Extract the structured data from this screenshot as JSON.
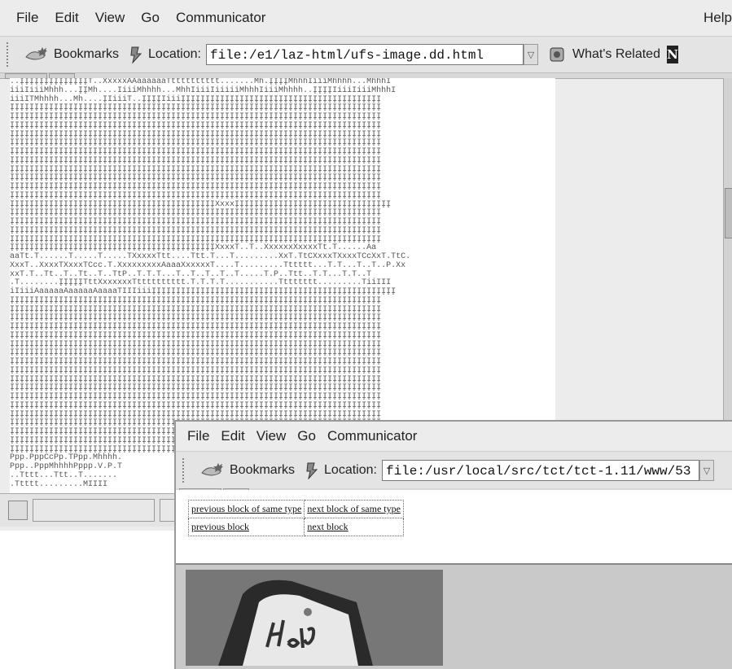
{
  "browser1": {
    "menu": [
      "File",
      "Edit",
      "View",
      "Go",
      "Communicator"
    ],
    "help": "Help",
    "bookmarks_label": "Bookmarks",
    "location_label": "Location:",
    "location_value": "file:/e1/laz-html/ufs-image.dd.html",
    "related_label": "What's Related",
    "content_ascii": [
      "..ĮĮĮĮĮĮĮĮĮĮĮĮĮĮT..XxxxxAAaaaaaaTtttttttttt.......Mh.ĮĮĮĮMhhhIiiiMhhhh...MhhhI",
      "iiiIiiiMhhh...ĮĮMh....IiiiMhhhh...MhhIiiiIiiiiiMhhhIiiiMhhhh..ĮĮĮĮIiiiIiiiMhhhI",
      "iiiITMhhhh...Mh....ĮIiiiT..ĮĮĮĮIiiiĮĮĮĮĮĮĮĮĮĮĮĮĮĮĮĮĮĮĮĮĮĮĮĮĮĮĮĮĮĮĮĮĮĮĮĮĮĮĮĮĮ",
      "ĮĮĮĮĮĮĮĮĮĮĮĮĮĮĮĮĮĮĮĮĮĮĮĮĮĮĮĮĮĮĮĮĮĮĮĮĮĮĮĮĮĮĮĮĮĮĮĮĮĮĮĮĮĮĮĮĮĮĮĮĮĮĮĮĮĮĮĮĮĮĮĮĮĮĮĮ",
      "ĮĮĮĮĮĮĮĮĮĮĮĮĮĮĮĮĮĮĮĮĮĮĮĮĮĮĮĮĮĮĮĮĮĮĮĮĮĮĮĮĮĮĮĮĮĮĮĮĮĮĮĮĮĮĮĮĮĮĮĮĮĮĮĮĮĮĮĮĮĮĮĮĮĮĮĮ",
      "ĮĮĮĮĮĮĮĮĮĮĮĮĮĮĮĮĮĮĮĮĮĮĮĮĮĮĮĮĮĮĮĮĮĮĮĮĮĮĮĮĮĮĮĮĮĮĮĮĮĮĮĮĮĮĮĮĮĮĮĮĮĮĮĮĮĮĮĮĮĮĮĮĮĮĮĮ",
      "ĮĮĮĮĮĮĮĮĮĮĮĮĮĮĮĮĮĮĮĮĮĮĮĮĮĮĮĮĮĮĮĮĮĮĮĮĮĮĮĮĮĮĮĮĮĮĮĮĮĮĮĮĮĮĮĮĮĮĮĮĮĮĮĮĮĮĮĮĮĮĮĮĮĮĮĮ",
      "ĮĮĮĮĮĮĮĮĮĮĮĮĮĮĮĮĮĮĮĮĮĮĮĮĮĮĮĮĮĮĮĮĮĮĮĮĮĮĮĮĮĮĮĮĮĮĮĮĮĮĮĮĮĮĮĮĮĮĮĮĮĮĮĮĮĮĮĮĮĮĮĮĮĮĮĮ",
      "ĮĮĮĮĮĮĮĮĮĮĮĮĮĮĮĮĮĮĮĮĮĮĮĮĮĮĮĮĮĮĮĮĮĮĮĮĮĮĮĮĮĮĮĮĮĮĮĮĮĮĮĮĮĮĮĮĮĮĮĮĮĮĮĮĮĮĮĮĮĮĮĮĮĮĮĮ",
      "ĮĮĮĮĮĮĮĮĮĮĮĮĮĮĮĮĮĮĮĮĮĮĮĮĮĮĮĮĮĮĮĮĮĮĮĮĮĮĮĮĮĮĮĮĮĮĮĮĮĮĮĮĮĮĮĮĮĮĮĮĮĮĮĮĮĮĮĮĮĮĮĮĮĮĮĮ",
      "ĮĮĮĮĮĮĮĮĮĮĮĮĮĮĮĮĮĮĮĮĮĮĮĮĮĮĮĮĮĮĮĮĮĮĮĮĮĮĮĮĮĮĮĮĮĮĮĮĮĮĮĮĮĮĮĮĮĮĮĮĮĮĮĮĮĮĮĮĮĮĮĮĮĮĮĮ",
      "ĮĮĮĮĮĮĮĮĮĮĮĮĮĮĮĮĮĮĮĮĮĮĮĮĮĮĮĮĮĮĮĮĮĮĮĮĮĮĮĮĮĮĮĮĮĮĮĮĮĮĮĮĮĮĮĮĮĮĮĮĮĮĮĮĮĮĮĮĮĮĮĮĮĮĮĮ",
      "ĮĮĮĮĮĮĮĮĮĮĮĮĮĮĮĮĮĮĮĮĮĮĮĮĮĮĮĮĮĮĮĮĮĮĮĮĮĮĮĮĮĮĮĮĮĮĮĮĮĮĮĮĮĮĮĮĮĮĮĮĮĮĮĮĮĮĮĮĮĮĮĮĮĮĮĮ",
      "ĮĮĮĮĮĮĮĮĮĮĮĮĮĮĮĮĮĮĮĮĮĮĮĮĮĮĮĮĮĮĮĮĮĮĮĮĮĮĮĮĮĮĮĮĮĮĮĮĮĮĮĮĮĮĮĮĮĮĮĮĮĮĮĮĮĮĮĮĮĮĮĮĮĮĮĮ",
      "ĮĮĮĮĮĮĮĮĮĮĮĮĮĮĮĮĮĮĮĮĮĮĮĮĮĮĮĮĮĮĮĮĮĮĮĮĮĮĮĮĮĮXxxxĮĮĮĮĮĮĮĮĮĮĮĮĮĮĮĮĮĮĮĮĮĮĮĮĮĮĮĮĮĮĮĮ",
      "ĮĮĮĮĮĮĮĮĮĮĮĮĮĮĮĮĮĮĮĮĮĮĮĮĮĮĮĮĮĮĮĮĮĮĮĮĮĮĮĮĮĮĮĮĮĮĮĮĮĮĮĮĮĮĮĮĮĮĮĮĮĮĮĮĮĮĮĮĮĮĮĮĮĮĮĮ",
      "ĮĮĮĮĮĮĮĮĮĮĮĮĮĮĮĮĮĮĮĮĮĮĮĮĮĮĮĮĮĮĮĮĮĮĮĮĮĮĮĮĮĮĮĮĮĮĮĮĮĮĮĮĮĮĮĮĮĮĮĮĮĮĮĮĮĮĮĮĮĮĮĮĮĮĮĮ",
      "ĮĮĮĮĮĮĮĮĮĮĮĮĮĮĮĮĮĮĮĮĮĮĮĮĮĮĮĮĮĮĮĮĮĮĮĮĮĮĮĮĮĮĮĮĮĮĮĮĮĮĮĮĮĮĮĮĮĮĮĮĮĮĮĮĮĮĮĮĮĮĮĮĮĮĮĮ",
      "ĮĮĮĮĮĮĮĮĮĮĮĮĮĮĮĮĮĮĮĮĮĮĮĮĮĮĮĮĮĮĮĮĮĮĮĮĮĮĮĮĮĮĮĮĮĮĮĮĮĮĮĮĮĮĮĮĮĮĮĮĮĮĮĮĮĮĮĮĮĮĮĮĮĮĮĮ",
      "ĮĮĮĮĮĮĮĮĮĮĮĮĮĮĮĮĮĮĮĮĮĮĮĮĮĮĮĮĮĮĮĮĮĮĮĮĮĮĮĮĮĮXxxxT..T..XxxxxxXxxxxTt.T......Aa",
      "aaTt.T......T.....T.....TXxxxxTtt....Ttt.T...T.........XxT.TtCXxxxTXxxxTCcXxT.TtC.",
      "XxxT..XxxxTXxxxTCcc.T.XxxxxxxxxAaaaXxxxxxT....T.........Tttttt...T.T...T..T..P.Xx",
      "xxT.T..Tt..T..Tt..T..TtP..T.T.T...T..T..T..T..T.....T.P..Ttt..T.T...T.T..T",
      ".T........ĮĮĮĮĮTttXxxxxxxTtttttttttt.T.T.T.T...........Tttttttt.........TiiIII",
      "iIiiiAaaaaaAaaaaaAaaaaTIIIiiiĮĮĮĮĮĮĮĮĮĮĮĮĮĮĮĮĮĮĮĮĮĮĮĮĮĮĮĮĮĮĮĮĮĮĮĮĮĮĮĮĮĮĮĮĮĮĮĮĮĮ",
      "ĮĮĮĮĮĮĮĮĮĮĮĮĮĮĮĮĮĮĮĮĮĮĮĮĮĮĮĮĮĮĮĮĮĮĮĮĮĮĮĮĮĮĮĮĮĮĮĮĮĮĮĮĮĮĮĮĮĮĮĮĮĮĮĮĮĮĮĮĮĮĮĮĮĮĮĮ",
      "ĮĮĮĮĮĮĮĮĮĮĮĮĮĮĮĮĮĮĮĮĮĮĮĮĮĮĮĮĮĮĮĮĮĮĮĮĮĮĮĮĮĮĮĮĮĮĮĮĮĮĮĮĮĮĮĮĮĮĮĮĮĮĮĮĮĮĮĮĮĮĮĮĮĮĮĮ",
      "ĮĮĮĮĮĮĮĮĮĮĮĮĮĮĮĮĮĮĮĮĮĮĮĮĮĮĮĮĮĮĮĮĮĮĮĮĮĮĮĮĮĮĮĮĮĮĮĮĮĮĮĮĮĮĮĮĮĮĮĮĮĮĮĮĮĮĮĮĮĮĮĮĮĮĮĮ",
      "ĮĮĮĮĮĮĮĮĮĮĮĮĮĮĮĮĮĮĮĮĮĮĮĮĮĮĮĮĮĮĮĮĮĮĮĮĮĮĮĮĮĮĮĮĮĮĮĮĮĮĮĮĮĮĮĮĮĮĮĮĮĮĮĮĮĮĮĮĮĮĮĮĮĮĮĮ",
      "ĮĮĮĮĮĮĮĮĮĮĮĮĮĮĮĮĮĮĮĮĮĮĮĮĮĮĮĮĮĮĮĮĮĮĮĮĮĮĮĮĮĮĮĮĮĮĮĮĮĮĮĮĮĮĮĮĮĮĮĮĮĮĮĮĮĮĮĮĮĮĮĮĮĮĮĮ",
      "ĮĮĮĮĮĮĮĮĮĮĮĮĮĮĮĮĮĮĮĮĮĮĮĮĮĮĮĮĮĮĮĮĮĮĮĮĮĮĮĮĮĮĮĮĮĮĮĮĮĮĮĮĮĮĮĮĮĮĮĮĮĮĮĮĮĮĮĮĮĮĮĮĮĮĮĮ",
      "ĮĮĮĮĮĮĮĮĮĮĮĮĮĮĮĮĮĮĮĮĮĮĮĮĮĮĮĮĮĮĮĮĮĮĮĮĮĮĮĮĮĮĮĮĮĮĮĮĮĮĮĮĮĮĮĮĮĮĮĮĮĮĮĮĮĮĮĮĮĮĮĮĮĮĮĮ",
      "ĮĮĮĮĮĮĮĮĮĮĮĮĮĮĮĮĮĮĮĮĮĮĮĮĮĮĮĮĮĮĮĮĮĮĮĮĮĮĮĮĮĮĮĮĮĮĮĮĮĮĮĮĮĮĮĮĮĮĮĮĮĮĮĮĮĮĮĮĮĮĮĮĮĮĮĮ",
      "ĮĮĮĮĮĮĮĮĮĮĮĮĮĮĮĮĮĮĮĮĮĮĮĮĮĮĮĮĮĮĮĮĮĮĮĮĮĮĮĮĮĮĮĮĮĮĮĮĮĮĮĮĮĮĮĮĮĮĮĮĮĮĮĮĮĮĮĮĮĮĮĮĮĮĮĮ",
      "ĮĮĮĮĮĮĮĮĮĮĮĮĮĮĮĮĮĮĮĮĮĮĮĮĮĮĮĮĮĮĮĮĮĮĮĮĮĮĮĮĮĮĮĮĮĮĮĮĮĮĮĮĮĮĮĮĮĮĮĮĮĮĮĮĮĮĮĮĮĮĮĮĮĮĮĮ",
      "ĮĮĮĮĮĮĮĮĮĮĮĮĮĮĮĮĮĮĮĮĮĮĮĮĮĮĮĮĮĮĮĮĮĮĮĮĮĮĮĮĮĮĮĮĮĮĮĮĮĮĮĮĮĮĮĮĮĮĮĮĮĮĮĮĮĮĮĮĮĮĮĮĮĮĮĮ",
      "ĮĮĮĮĮĮĮĮĮĮĮĮĮĮĮĮĮĮĮĮĮĮĮĮĮĮĮĮĮĮĮĮĮĮĮĮĮĮĮĮĮĮĮĮĮĮĮĮĮĮĮĮĮĮĮĮĮĮĮĮĮĮĮĮĮĮĮĮĮĮĮĮĮĮĮĮ",
      "ĮĮĮĮĮĮĮĮĮĮĮĮĮĮĮĮĮĮĮĮĮĮĮĮĮĮĮĮĮĮĮĮĮĮĮĮĮĮĮĮĮĮĮĮĮĮĮĮĮĮĮĮĮĮĮĮĮĮĮĮĮĮĮĮĮĮĮĮĮĮĮĮĮĮĮĮ",
      "ĮĮĮĮĮĮĮĮĮĮĮĮĮĮĮĮĮĮĮĮĮĮĮĮĮĮĮĮĮĮĮĮĮĮĮĮĮĮĮĮĮĮĮĮĮĮĮĮĮĮĮĮĮĮĮĮĮĮĮĮĮĮĮĮĮĮĮĮĮĮĮĮĮĮĮĮ",
      "ĮĮĮĮĮĮĮĮĮĮĮĮĮĮĮĮĮĮĮĮĮĮĮĮĮĮĮĮĮĮĮĮĮĮĮĮĮĮĮĮĮĮĮĮĮĮĮĮĮĮĮĮĮĮĮĮĮĮĮĮĮĮĮĮĮĮĮĮĮĮĮĮĮĮĮĮ",
      "ĮĮĮĮĮĮĮĮĮĮĮĮĮĮĮĮĮĮĮĮĮĮĮĮĮĮĮĮĮĮĮĮĮĮĮĮĮĮĮĮĮĮĮĮĮĮĮĮĮĮĮĮĮĮĮĮĮĮĮĮĮĮĮĮĮĮĮĮĮĮĮĮĮĮĮĮ",
      "ĮĮĮĮĮĮĮĮĮĮĮĮĮĮĮĮĮĮĮĮĮĮĮĮĮĮĮĮĮĮĮĮĮĮĮĮĮĮĮĮĮĮĮĮĮĮĮĮĮĮĮĮĮĮĮĮĮĮĮĮĮĮĮĮĮĮĮĮĮĮĮĮĮĮĮĮ",
      "ĮĮĮĮĮĮĮĮĮĮĮĮĮĮĮĮĮĮĮĮĮĮĮĮĮĮĮĮĮĮĮĮĮĮĮĮĮĮĮĮĮĮĮĮĮĮĮĮĮĮĮĮĮĮĮĮĮĮĮĮĮĮĮĮĮĮĮĮĮĮĮĮĮĮĮĮ",
      "Ppp.PppCcPp.TPpp.Mhhhh.",
      "Ppp..PppMhhhhPppp.V.P.T",
      "..Tttt...Ttt..T.......",
      ".Ttttt.........MIIII"
    ]
  },
  "browser2": {
    "menu": [
      "File",
      "Edit",
      "View",
      "Go",
      "Communicator"
    ],
    "bookmarks_label": "Bookmarks",
    "location_label": "Location:",
    "location_value": "file:/usr/local/src/tct/tct-1.11/www/53",
    "nav": {
      "prev_same": "previous block of same type",
      "next_same": "next block of same type",
      "prev": "previous block",
      "next": "next block"
    }
  }
}
